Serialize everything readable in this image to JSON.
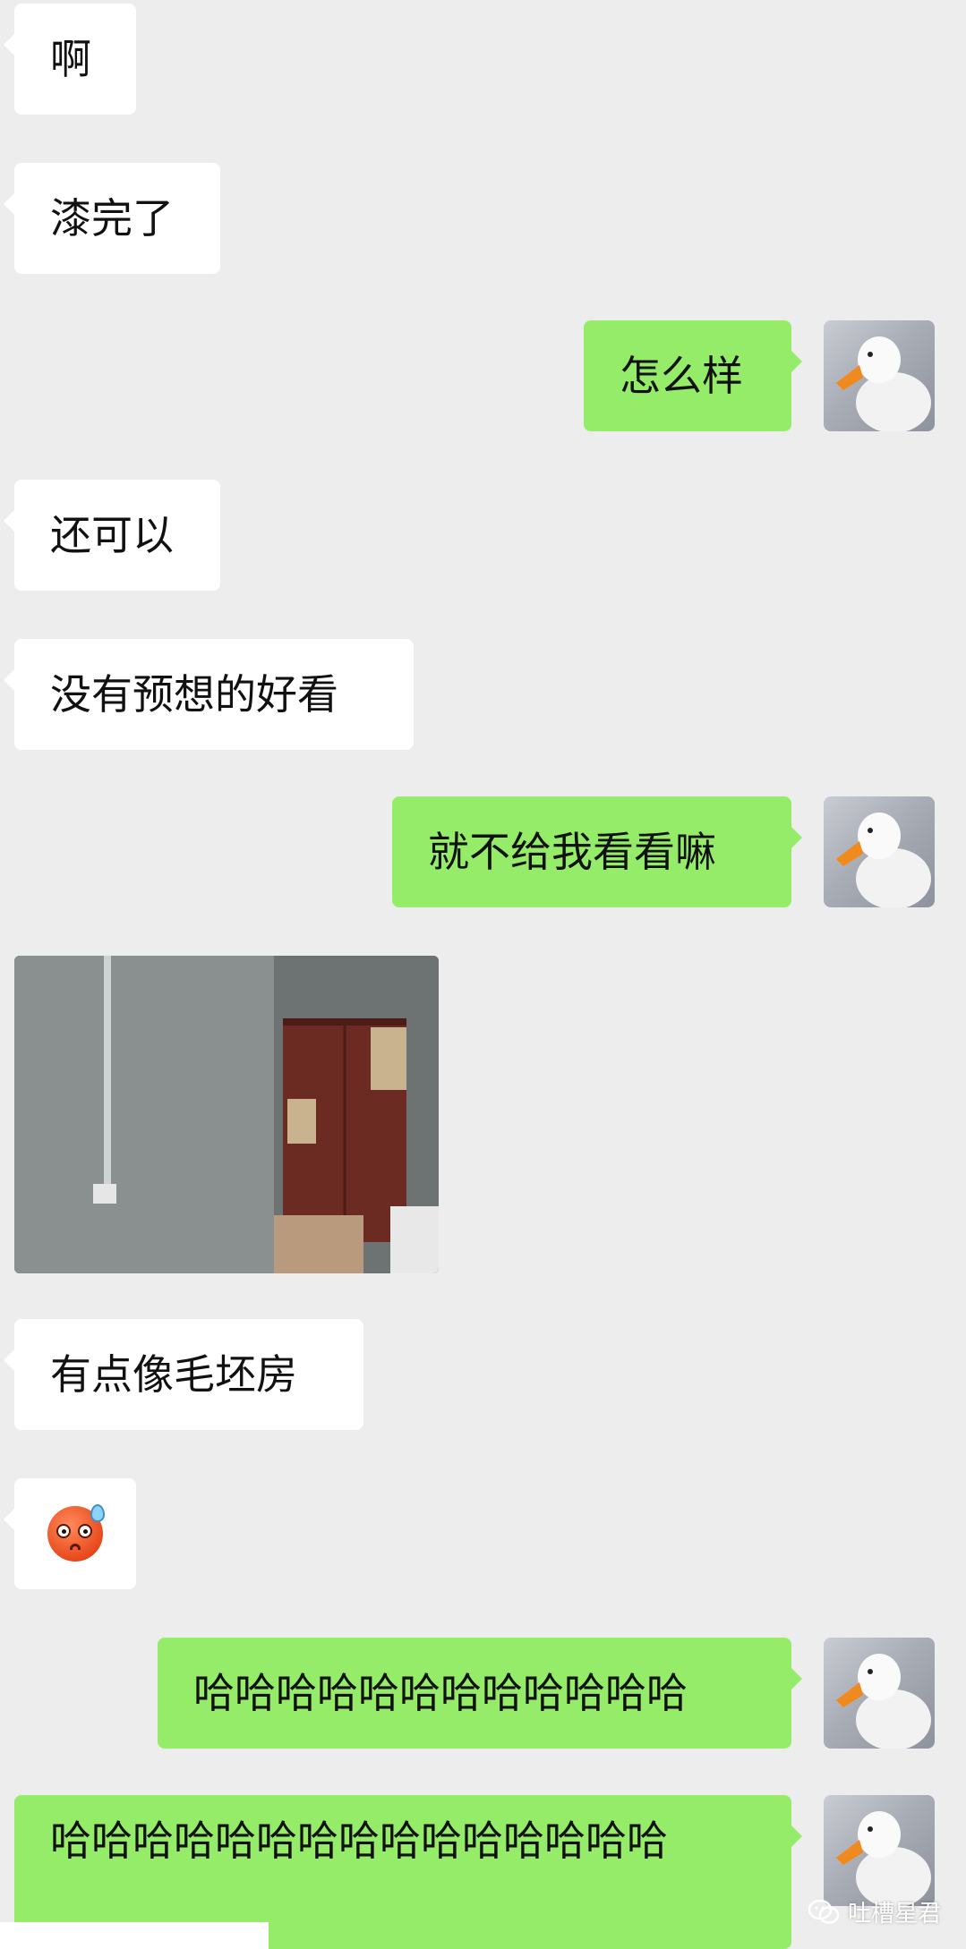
{
  "messages": [
    {
      "side": "in",
      "text": "啊"
    },
    {
      "side": "in",
      "text": "漆完了"
    },
    {
      "side": "out",
      "text": "怎么样"
    },
    {
      "side": "in",
      "text": "还可以"
    },
    {
      "side": "in",
      "text": "没有预想的好看"
    },
    {
      "side": "out",
      "text": "就不给我看看嘛"
    },
    {
      "side": "in",
      "type": "image",
      "text": ""
    },
    {
      "side": "in",
      "text": "有点像毛坯房"
    },
    {
      "side": "in",
      "type": "emoji",
      "text": "",
      "emoji": "sweat-face-emoji"
    },
    {
      "side": "out",
      "text": "哈哈哈哈哈哈哈哈哈哈哈哈"
    },
    {
      "side": "out",
      "text": "哈哈哈哈哈哈哈哈哈哈哈哈哈哈哈"
    }
  ],
  "watermark": {
    "text": "吐槽星君",
    "icon": "wechat-logo-icon"
  },
  "colors": {
    "background": "#ededed",
    "incoming": "#ffffff",
    "outgoing": "#95ec69"
  }
}
